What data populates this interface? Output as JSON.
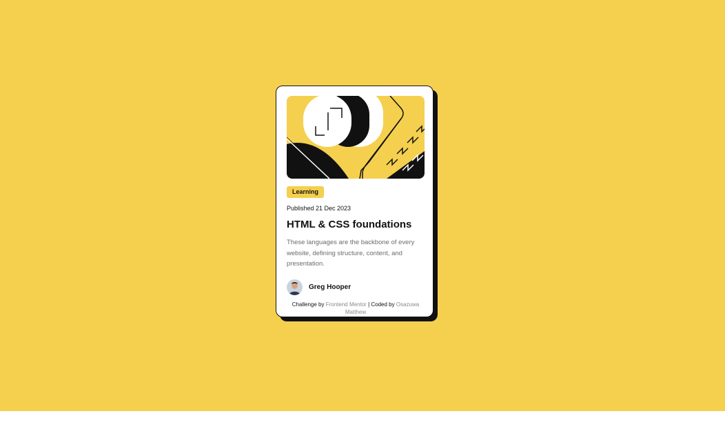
{
  "colors": {
    "page_background": "#f4d04e",
    "card_background": "#ffffff",
    "ink": "#111111",
    "muted_text": "#6b6b6b",
    "link": "#8a8a8a"
  },
  "card": {
    "illustration": "blog-illustration",
    "tag": "Learning",
    "published": "Published 21 Dec 2023",
    "title": "HTML & CSS foundations",
    "description": "These languages are the backbone of every website, defining structure, content, and presentation.",
    "author": {
      "name": "Greg Hooper",
      "avatar_icon": "avatar-photo"
    }
  },
  "attribution": {
    "prefix": "Challenge by",
    "link_text": "Frontend Mentor",
    "separator": "| Coded by",
    "author_link": "Osazuwa Matthew"
  }
}
